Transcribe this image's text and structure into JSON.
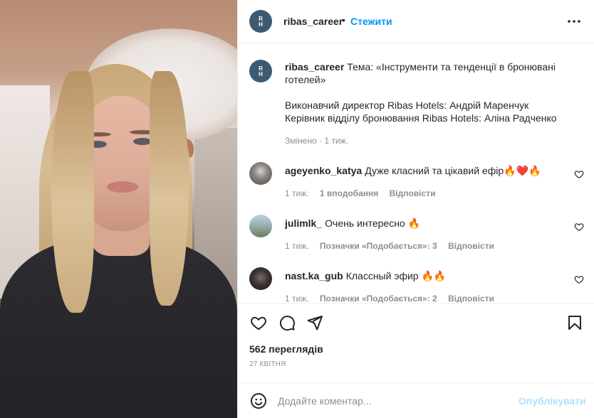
{
  "post": {
    "account": "ribas_career",
    "follow_label": "Стежити",
    "dot": "•",
    "more_icon": "more-horizontal-icon",
    "brand_color": "#3d5a73",
    "accent_color": "#0095f6"
  },
  "caption": {
    "username": "ribas_career",
    "line1": "Тема: «Інструменти та тенденції в бронювані готелей»",
    "line2": "Виконавчий директор Ribas Hotels: Андрій Маренчук",
    "line3": "Керівник відділу бронювання Ribas Hotels: Аліна Радченко",
    "meta": "Змінено · 1 тиж."
  },
  "comments": [
    {
      "username": "ageyenko_katya",
      "text": "Дуже класний та цікавий ефір🔥❤️🔥",
      "time": "1 тиж.",
      "likes": "1 вподобання",
      "reply": "Відповісти",
      "avatar_color": "#5b5a58"
    },
    {
      "username": "julimlk_",
      "text": "Очень интересно 🔥",
      "time": "1 тиж.",
      "likes": "Позначки «Подобається»: 3",
      "reply": "Відповісти",
      "avatar_color": "#7d8a6a"
    },
    {
      "username": "nast.ka_gub",
      "text": "Классный эфир 🔥🔥",
      "time": "1 тиж.",
      "likes": "Позначки «Подобається»: 2",
      "reply": "Відповісти",
      "avatar_color": "#2a2624"
    }
  ],
  "stats": {
    "views": "562 переглядів",
    "date": "27 КВІТНЯ"
  },
  "composer": {
    "placeholder": "Додайте коментар...",
    "post_label": "Опублікувати",
    "post_color": "#b2dffc"
  }
}
